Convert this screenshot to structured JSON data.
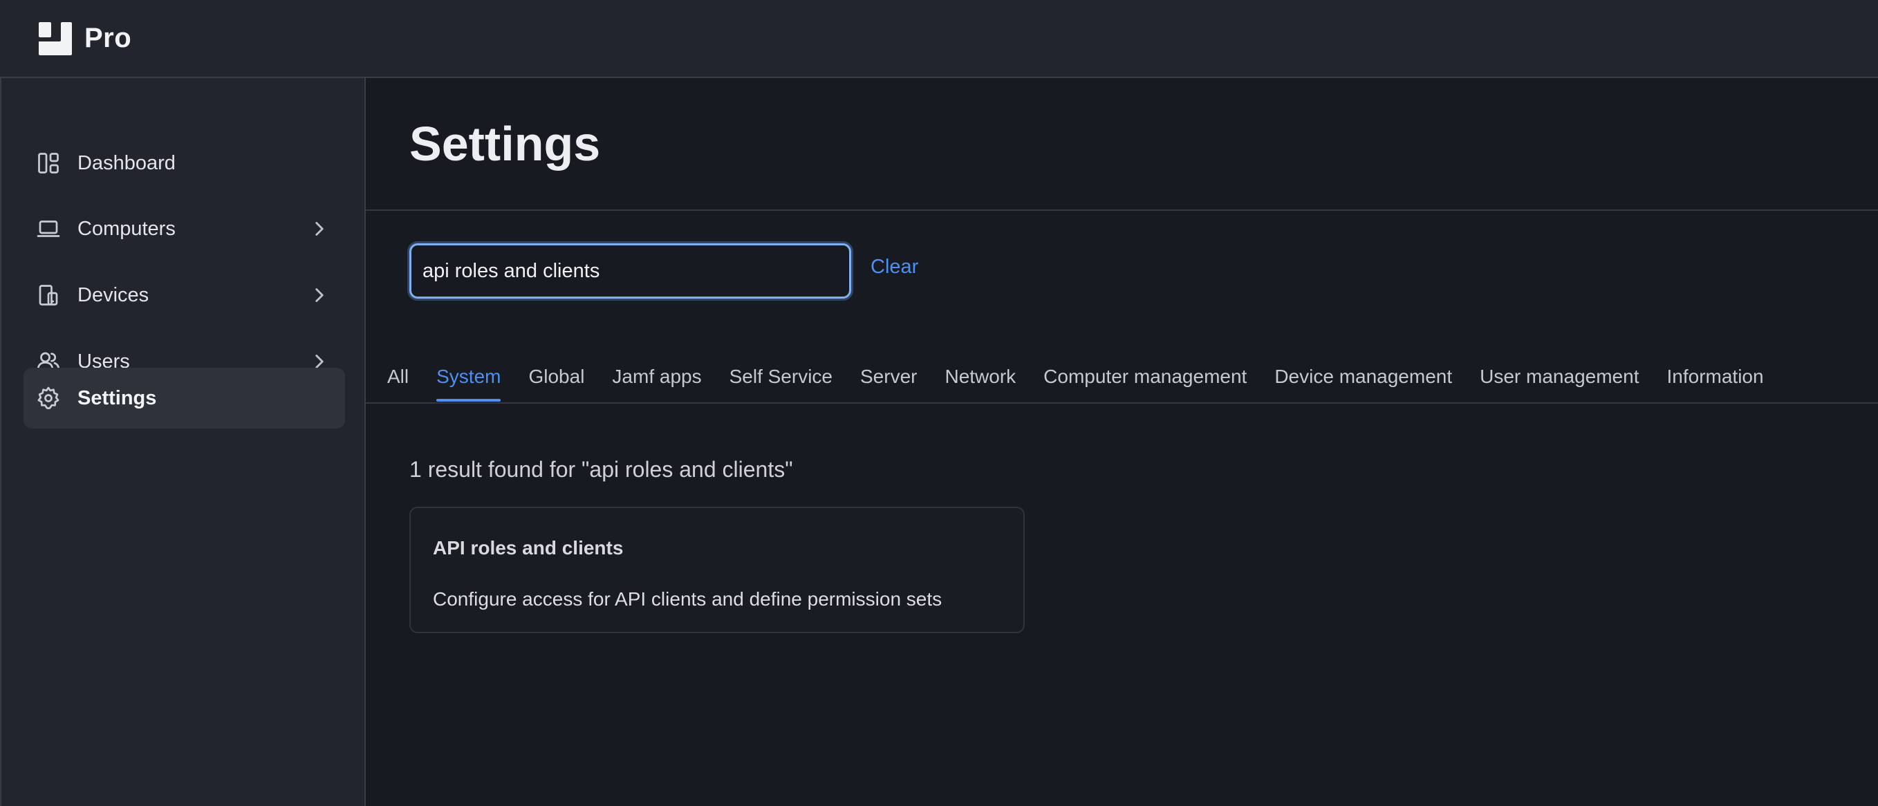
{
  "app": {
    "name": "Pro"
  },
  "sidebar": {
    "items": [
      {
        "label": "Dashboard",
        "icon": "dashboard-icon",
        "has_chevron": false,
        "active": false
      },
      {
        "label": "Computers",
        "icon": "laptop-icon",
        "has_chevron": true,
        "active": false
      },
      {
        "label": "Devices",
        "icon": "devices-icon",
        "has_chevron": true,
        "active": false
      },
      {
        "label": "Users",
        "icon": "users-icon",
        "has_chevron": true,
        "active": false
      },
      {
        "label": "Settings",
        "icon": "gear-icon",
        "has_chevron": false,
        "active": true
      }
    ]
  },
  "page": {
    "title": "Settings"
  },
  "search": {
    "value": "api roles and clients",
    "clear_label": "Clear"
  },
  "tabs": [
    {
      "label": "All",
      "active": false
    },
    {
      "label": "System",
      "active": true
    },
    {
      "label": "Global",
      "active": false
    },
    {
      "label": "Jamf apps",
      "active": false
    },
    {
      "label": "Self Service",
      "active": false
    },
    {
      "label": "Server",
      "active": false
    },
    {
      "label": "Network",
      "active": false
    },
    {
      "label": "Computer management",
      "active": false
    },
    {
      "label": "Device management",
      "active": false
    },
    {
      "label": "User management",
      "active": false
    },
    {
      "label": "Information",
      "active": false
    }
  ],
  "results": {
    "summary": "1 result found for \"api roles and clients\"",
    "items": [
      {
        "title": "API roles and clients",
        "description": "Configure access for API clients and define permission sets"
      }
    ]
  },
  "colors": {
    "accent": "#4f8ff0",
    "background": "#171a21",
    "sidebar_bg": "#22252e",
    "active_item_bg": "#2e323b"
  }
}
